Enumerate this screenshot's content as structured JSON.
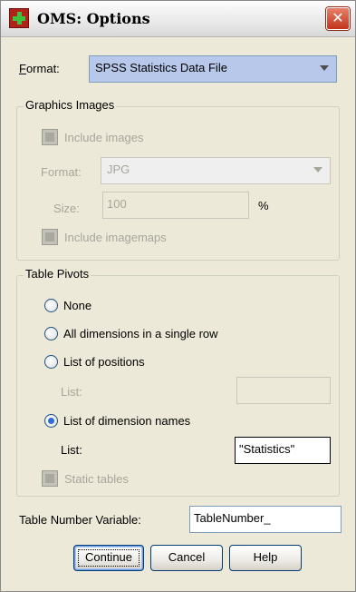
{
  "window": {
    "title": "OMS: Options",
    "close_label": "✕"
  },
  "format": {
    "label": "Format:",
    "value": "SPSS Statistics Data File"
  },
  "graphics": {
    "legend": "Graphics Images",
    "include_images": "Include images",
    "format_label": "Format:",
    "format_value": "JPG",
    "size_label": "Size:",
    "size_value": "100",
    "size_unit": "%",
    "include_imagemaps": "Include imagemaps"
  },
  "pivots": {
    "legend": "Table Pivots",
    "option_none": "None",
    "option_single_row": "All dimensions in a single row",
    "option_positions": "List of positions",
    "positions_list_label": "List:",
    "positions_list_value": "",
    "option_dimension_names": "List of dimension names",
    "names_list_label": "List:",
    "names_list_value": "\"Statistics\"",
    "static_tables": "Static tables",
    "selected": "List of dimension names"
  },
  "table_number": {
    "label": "Table Number Variable:",
    "value": "TableNumber_"
  },
  "buttons": {
    "continue": "Continue",
    "cancel": "Cancel",
    "help": "Help"
  }
}
